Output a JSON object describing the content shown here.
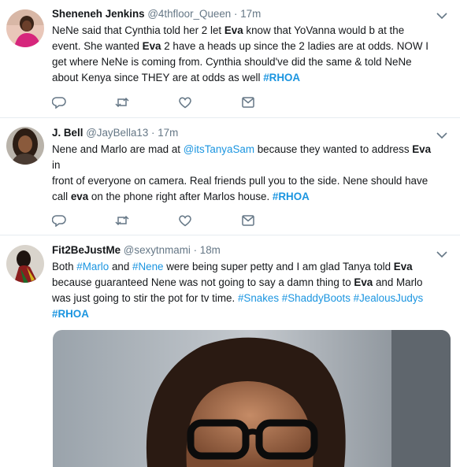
{
  "tweets": [
    {
      "name": "Sheneneh Jenkins",
      "handle": "@4thfloor_Queen",
      "dot": "·",
      "time": "17m",
      "lines": [
        [
          "NeNe said that Cynthia told her 2 let ",
          "Eva",
          " know that YoVanna would b at the"
        ],
        [
          "event. She wanted ",
          "Eva",
          " 2 have a heads up since the 2 ladies are at odds. NOW I"
        ],
        [
          "get where NeNe is coming from. Cynthia should've did the same & told NeNe"
        ],
        [
          "about Kenya since THEY are at odds as well ",
          "#RHOA"
        ]
      ]
    },
    {
      "name": "J. Bell",
      "handle": "@JayBella13",
      "dot": "·",
      "time": "17m",
      "lines": [
        [
          "Nene and Marlo are mad at ",
          "@itsTanyaSam",
          " because they wanted to address ",
          "Eva"
        ],
        [
          "in"
        ],
        [
          "front of everyone on camera. Real friends pull you to the side. Nene should have"
        ],
        [
          "call ",
          "eva",
          " on the phone right after Marlos house. ",
          "#RHOA"
        ]
      ]
    },
    {
      "name": "Fit2BeJustMe",
      "handle": "@sexytnmami",
      "dot": "·",
      "time": "18m",
      "lines": [
        [
          "Both ",
          "#Marlo",
          " and ",
          "#Nene",
          " were being super petty and I am glad Tanya told ",
          "Eva"
        ],
        [
          "because guaranteed Nene was not going to say a damn thing to ",
          "Eva",
          " and Marlo"
        ],
        [
          "was just going to stir the pot for tv time. ",
          "#Snakes",
          " ",
          "#ShaddyBoots",
          " ",
          "#JealousJudys"
        ],
        [
          "#RHOA"
        ]
      ]
    }
  ],
  "icons": {
    "reply": "reply-icon",
    "retweet": "retweet-icon",
    "like": "heart-icon",
    "dm": "envelope-icon",
    "caret": "chevron-down-icon"
  },
  "colors": {
    "link": "#1b95e0",
    "secondary": "#657786",
    "text": "#14171a",
    "divider": "#e6ecf0"
  }
}
